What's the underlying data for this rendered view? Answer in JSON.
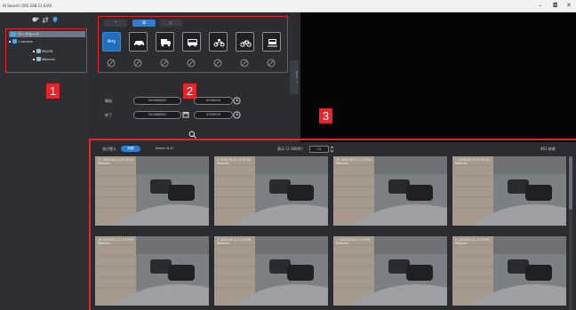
{
  "window": {
    "title": "AI Search (192.168.11.6/AI)",
    "controls": [
      "–",
      "◘",
      "✕"
    ]
  },
  "sidebar": {
    "tree": {
      "root_label": "ワークモード",
      "group_label": "1 camera",
      "items": [
        "IPAGTB",
        "Webcam"
      ]
    }
  },
  "badges": [
    "1",
    "2",
    "3"
  ],
  "filters": {
    "collapse_icon": "^",
    "modes": [
      "車",
      "人"
    ],
    "vehicle_types": [
      {
        "label": "Any",
        "icon": "any",
        "selected": true
      },
      {
        "label": "",
        "icon": "car-icon",
        "selected": false
      },
      {
        "label": "",
        "icon": "truck-icon",
        "selected": false
      },
      {
        "label": "",
        "icon": "bus-icon",
        "selected": false
      },
      {
        "label": "",
        "icon": "motorcycle-icon",
        "selected": false
      },
      {
        "label": "",
        "icon": "bicycle-icon",
        "selected": false
      },
      {
        "label": "",
        "icon": "train-icon",
        "selected": false
      }
    ],
    "start_label": "開始",
    "end_label": "終了",
    "start_date": "2024/06/01",
    "start_time": "00:00:00",
    "end_date": "2024/06/01",
    "end_time": "23:59:59",
    "search_icon": "search-icon",
    "collapse_tab": "Filters ▸"
  },
  "results": {
    "sort_label": "並び替え",
    "sort_active": "時間",
    "sort_other": "Name (A-Z)",
    "page_size_label": "表示 (1-100件)",
    "page_size_value": "15",
    "count_label": "461 結果",
    "thumbnails": [
      {
        "caption": "72. 2024-06-12 11:20:34",
        "camera": "Webcam"
      },
      {
        "caption": "3. 2024-06-12 11:20:34",
        "camera": "Webcam"
      },
      {
        "caption": "20. 2024-06-12 11:20:10",
        "camera": "Webcam"
      },
      {
        "caption": "1. 2024-06-12 11:20:10",
        "camera": "Webcam"
      },
      {
        "caption": "16. 2024-06-12 11:19:58",
        "camera": "Webcam"
      },
      {
        "caption": "2. 2024-06-12 11:19:58",
        "camera": "Webcam"
      },
      {
        "caption": "7. 2024-06-12 11:19:50",
        "camera": "Webcam"
      },
      {
        "caption": "4. 2024-06-12 11:19:50",
        "camera": "Webcam"
      }
    ]
  },
  "colors": {
    "highlight_border": "#e8242b",
    "selected_accent": "#1f6fc1",
    "sidebar_bg": "#2d2f33"
  }
}
